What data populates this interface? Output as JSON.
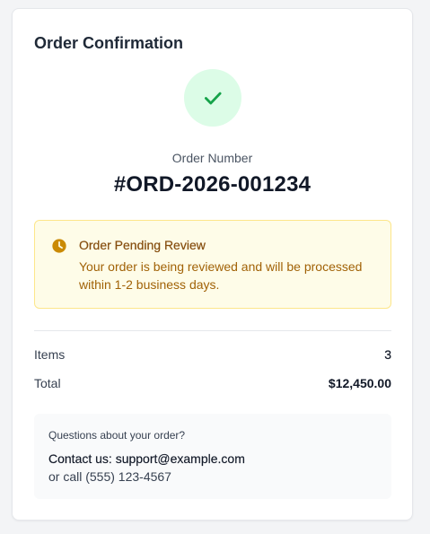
{
  "card": {
    "title": "Order Confirmation",
    "success_icon": "checkmark-icon"
  },
  "order": {
    "number_label": "Order Number",
    "number": "#ORD-2026-001234"
  },
  "alert": {
    "icon": "clock-icon",
    "title": "Order Pending Review",
    "message": "Your order is being reviewed and will be processed within 1-2 business days."
  },
  "summary": {
    "items_label": "Items",
    "items_value": "3",
    "total_label": "Total",
    "total_value": "$12,450.00"
  },
  "support": {
    "question": "Questions about your order?",
    "contact": "Contact us: support@example.com",
    "phone": "or call (555) 123-4567"
  },
  "colors": {
    "success_bg": "#dcfce7",
    "success_icon": "#16a34a",
    "alert_bg": "#fefce8",
    "alert_border": "#fde68a",
    "alert_title": "#854d0e",
    "alert_text": "#a16207",
    "alert_icon": "#ca8a04"
  }
}
